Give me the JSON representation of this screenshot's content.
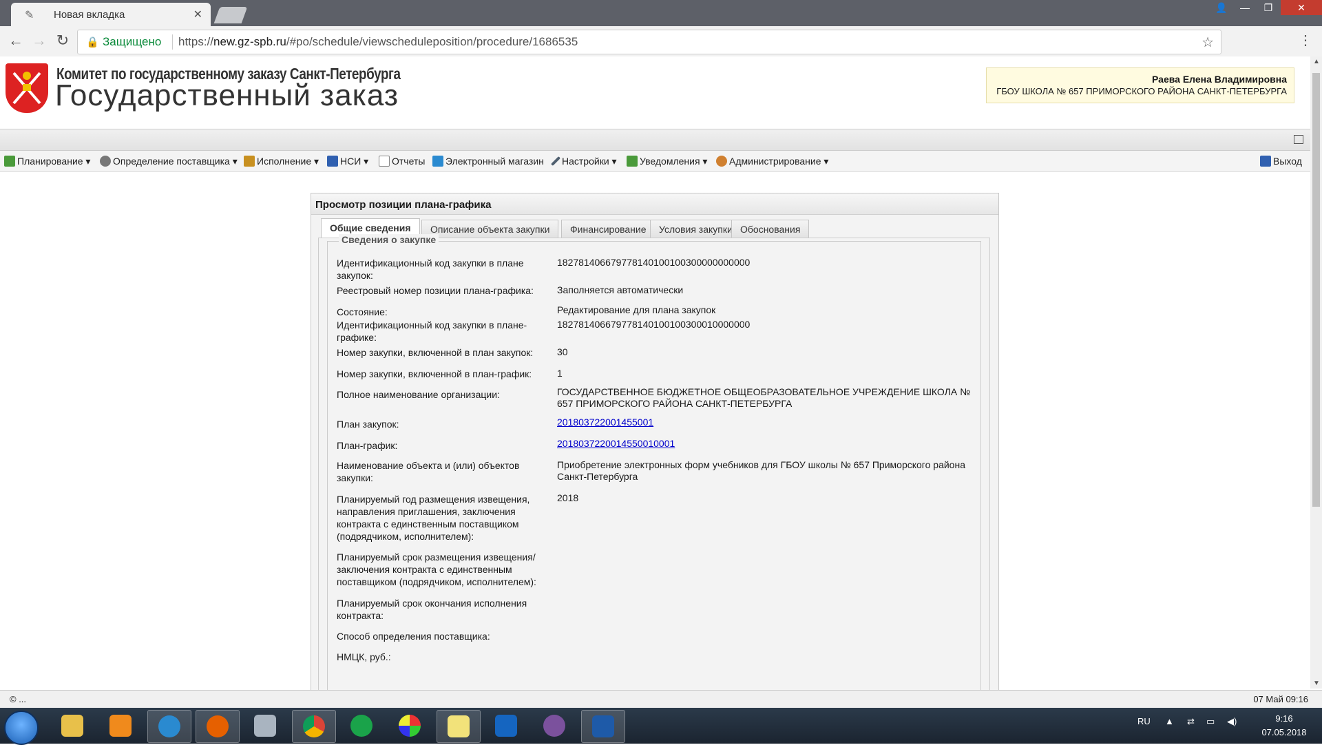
{
  "browser": {
    "tab_title": "Новая вкладка",
    "secure_label": "Защищено",
    "url_scheme": "https://",
    "url_host": "new.gz-spb.ru",
    "url_path": "/#po/schedule/viewscheduleposition/procedure/1686535"
  },
  "header": {
    "org_line": "Комитет по государственному заказу Санкт-Петербурга",
    "site_title": "Государственный заказ",
    "user_name": "Раева Елена Владимировна",
    "user_org": "ГБОУ ШКОЛА № 657 ПРИМОРСКОГО РАЙОНА САНКТ-ПЕТЕРБУРГА"
  },
  "menu": {
    "items": [
      {
        "label": "Планирование",
        "icon": "planning-icon",
        "color": "#4a9a3a"
      },
      {
        "label": "Определение поставщика",
        "icon": "gears-icon",
        "color": "#777777"
      },
      {
        "label": "Исполнение",
        "icon": "box-icon",
        "color": "#c89020"
      },
      {
        "label": "НСИ",
        "icon": "book-icon",
        "color": "#3060b0"
      },
      {
        "label": "Отчеты",
        "icon": "report-icon",
        "color": "#888888"
      },
      {
        "label": "Электронный магазин",
        "icon": "cart-icon",
        "color": "#2a8ad0"
      },
      {
        "label": "Настройки",
        "icon": "wrench-icon",
        "color": "#506070"
      },
      {
        "label": "Уведомления",
        "icon": "notification-icon",
        "color": "#4a9a3a"
      },
      {
        "label": "Администрирование",
        "icon": "user-icon",
        "color": "#d08030"
      }
    ],
    "logout": "Выход"
  },
  "panel": {
    "title": "Просмотр позиции плана-графика",
    "tabs": [
      "Общие сведения",
      "Описание объекта закупки",
      "Финансирование",
      "Условия закупки",
      "Обоснования"
    ],
    "section_title": "Сведения о закупке",
    "rows": [
      {
        "label": "Идентификационный код закупки в плане закупок:",
        "value": "182781406679778140100100300000000000"
      },
      {
        "label": "Реестровый номер позиции плана-графика:",
        "value": "Заполняется автоматически"
      },
      {
        "label": "Состояние:",
        "value": "Редактирование для плана закупок"
      },
      {
        "label": "Идентификационный код закупки в плане-графике:",
        "value": "182781406679778140100100300010000000"
      },
      {
        "label": "Номер закупки, включенной в план закупок:",
        "value": "30"
      },
      {
        "label": "Номер закупки, включенной в план-график:",
        "value": "1"
      },
      {
        "label": "Полное наименование организации:",
        "value": "ГОСУДАРСТВЕННОЕ БЮДЖЕТНОЕ ОБЩЕОБРАЗОВАТЕЛЬНОЕ УЧРЕЖДЕНИЕ ШКОЛА № 657 ПРИМОРСКОГО РАЙОНА САНКТ-ПЕТЕРБУРГА"
      },
      {
        "label": "План закупок:",
        "value": "201803722001455001"
      },
      {
        "label": "План-график:",
        "value": "2018037220014550010001"
      },
      {
        "label": "Наименование объекта и (или) объектов закупки:",
        "value": "Приобретение электронных форм учебников для ГБОУ школы № 657 Приморского района Санкт-Петербурга"
      },
      {
        "label": "Планируемый год размещения извещения, направления приглашения, заключения контракта с единственным поставщиком (подрядчиком, исполнителем):",
        "value": "2018"
      },
      {
        "label": "Планируемый срок размещения извещения/ заключения контракта с единственным поставщиком (подрядчиком, исполнителем):",
        "value": ""
      },
      {
        "label": "Планируемый срок окончания исполнения контракта:",
        "value": ""
      },
      {
        "label": "Способ определения поставщика:",
        "value": ""
      },
      {
        "label": "НМЦК, руб.:",
        "value": ""
      }
    ]
  },
  "status": {
    "left": "© ...",
    "right": "07 Май 09:16"
  },
  "taskbar": {
    "lang": "RU",
    "time": "9:16",
    "date": "07.05.2018"
  }
}
